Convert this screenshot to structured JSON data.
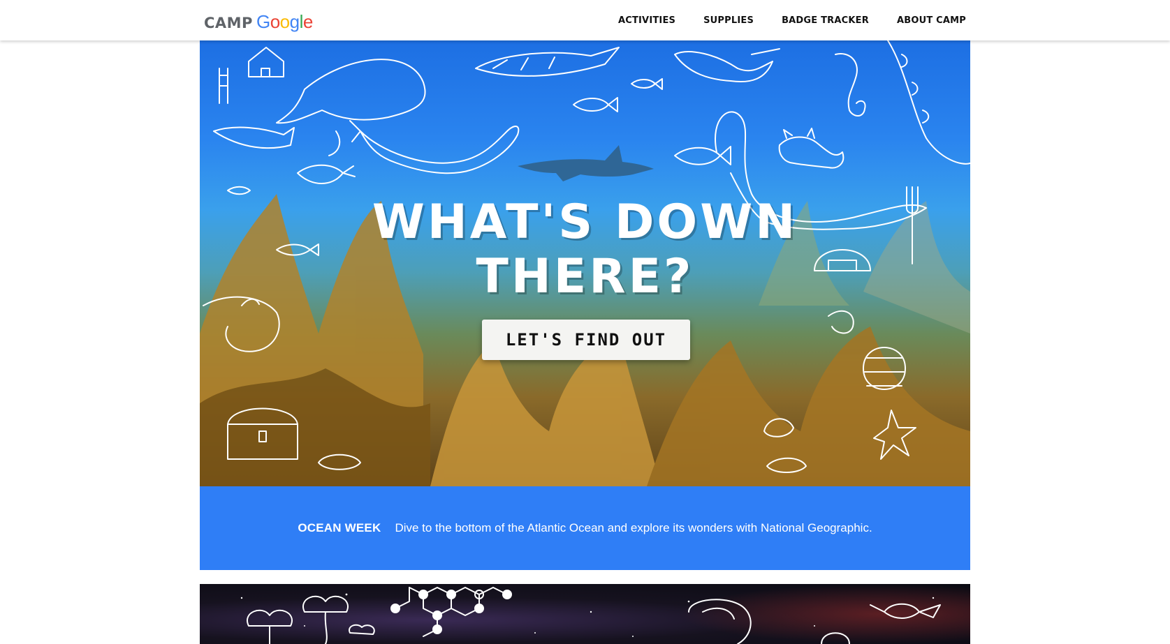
{
  "header": {
    "logo_prefix": "CAMP",
    "logo_letters": [
      "G",
      "o",
      "o",
      "g",
      "l",
      "e"
    ],
    "nav": [
      {
        "label": "ACTIVITIES"
      },
      {
        "label": "SUPPLIES"
      },
      {
        "label": "BADGE TRACKER"
      },
      {
        "label": "ABOUT CAMP"
      }
    ]
  },
  "hero": {
    "title": "WHAT'S DOWN\nTHERE?",
    "cta_label": "LET'S FIND OUT"
  },
  "week": {
    "label": "OCEAN WEEK",
    "description": "Dive to the bottom of the Atlantic Ocean and explore its wonders with National Geographic."
  },
  "colors": {
    "google": [
      "#4285F4",
      "#EA4335",
      "#FBBC05",
      "#4285F4",
      "#34A853",
      "#EA4335"
    ],
    "week_bar": "#2f7ef6"
  },
  "icons": [
    "whale-doodle",
    "shark-doodle",
    "fish-doodle",
    "mermaid-doodle",
    "seahorse-doodle",
    "octopus-doodle",
    "treasure-chest-doodle",
    "starfish-doodle",
    "shell-doodle",
    "molecule-doodle",
    "cloud-tree-doodle"
  ]
}
